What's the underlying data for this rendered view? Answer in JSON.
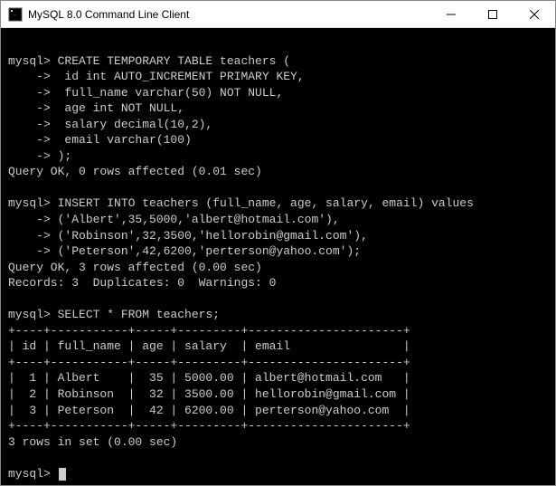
{
  "titlebar": {
    "title": "MySQL 8.0 Command Line Client"
  },
  "terminal": {
    "prompt": "mysql>",
    "cont_prompt": "    ->",
    "blank": "",
    "create_lines": [
      "mysql> CREATE TEMPORARY TABLE teachers (",
      "    ->  id int AUTO_INCREMENT PRIMARY KEY,",
      "    ->  full_name varchar(50) NOT NULL,",
      "    ->  age int NOT NULL,",
      "    ->  salary decimal(10,2),",
      "    ->  email varchar(100)",
      "    -> );"
    ],
    "create_result": "Query OK, 0 rows affected (0.01 sec)",
    "insert_lines": [
      "mysql> INSERT INTO teachers (full_name, age, salary, email) values",
      "    -> ('Albert',35,5000,'albert@hotmail.com'),",
      "    -> ('Robinson',32,3500,'hellorobin@gmail.com'),",
      "    -> ('Peterson',42,6200,'perterson@yahoo.com');"
    ],
    "insert_result1": "Query OK, 3 rows affected (0.00 sec)",
    "insert_result2": "Records: 3  Duplicates: 0  Warnings: 0",
    "select_line": "mysql> SELECT * FROM teachers;",
    "table_border": "+----+-----------+-----+---------+----------------------+",
    "table_header": "| id | full_name | age | salary  | email                |",
    "table_rows": [
      "|  1 | Albert    |  35 | 5000.00 | albert@hotmail.com   |",
      "|  2 | Robinson  |  32 | 3500.00 | hellorobin@gmail.com |",
      "|  3 | Peterson  |  42 | 6200.00 | perterson@yahoo.com  |"
    ],
    "select_result": "3 rows in set (0.00 sec)",
    "final_prompt": "mysql> "
  }
}
